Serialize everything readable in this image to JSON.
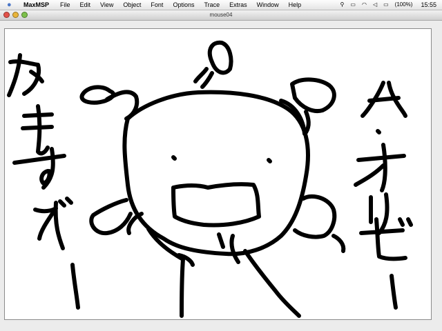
{
  "menubar": {
    "apple_icon": "apple-icon",
    "app_name": "MaxMSP",
    "menus": [
      "File",
      "Edit",
      "View",
      "Object",
      "Font",
      "Options",
      "Trace",
      "Extras",
      "Window",
      "Help"
    ],
    "battery": "(100%)",
    "clock": "15:55"
  },
  "window": {
    "title": "mouse04"
  },
  "drawing": {
    "description_icon": "hand-drawn-sketch"
  }
}
